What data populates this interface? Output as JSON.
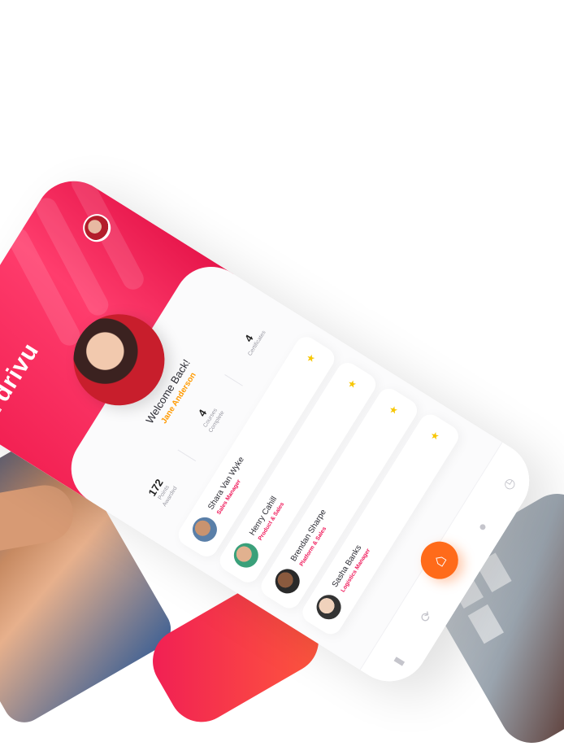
{
  "app": {
    "logo_text": "drivu"
  },
  "profile": {
    "welcome": "Welcome Back!",
    "name": "Jane Anderson"
  },
  "stats": [
    {
      "value": "172",
      "label_1": "Points",
      "label_2": "Awarded"
    },
    {
      "value": "4",
      "label_1": "Courses",
      "label_2": "Complete"
    },
    {
      "value": "4",
      "label_1": "Certificates",
      "label_2": ""
    }
  ],
  "team": [
    {
      "name": "Shara Van Wyke",
      "role": "Sales Manager"
    },
    {
      "name": "Henry Cahill",
      "role": "Product & Sales"
    },
    {
      "name": "Brendan Sharpe",
      "role": "Platform & Sales"
    },
    {
      "name": "Sasha Banks",
      "role": "Logistics Manager"
    }
  ],
  "icons": {
    "logo": "drivu-logo-icon",
    "star": "star-icon",
    "home": "home-icon",
    "history": "history-icon",
    "profile": "user-icon",
    "refresh": "refresh-icon",
    "book": "book-icon"
  },
  "colors": {
    "brand_red": "#f11e50",
    "accent_orange": "#ff6b1a",
    "name_orange": "#ff9a00",
    "role_pink": "#f0195a",
    "star_yellow": "#f7c600"
  }
}
